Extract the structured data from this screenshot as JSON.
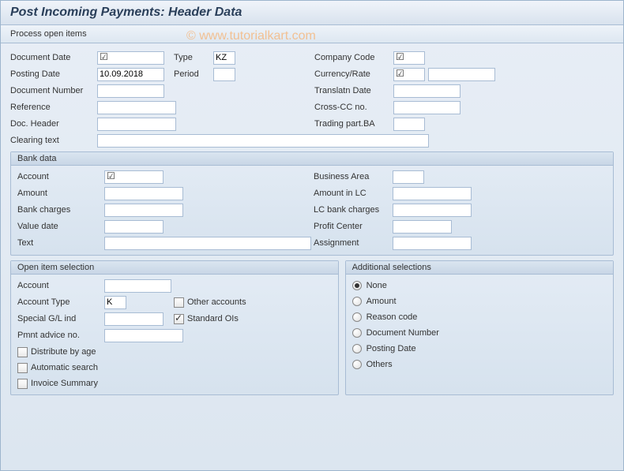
{
  "title": "Post Incoming Payments: Header Data",
  "toolbar": {
    "process_open_items": "Process open items"
  },
  "header": {
    "document_date_label": "Document Date",
    "document_date_value": "",
    "type_label": "Type",
    "type_value": "KZ",
    "company_code_label": "Company Code",
    "company_code_value": "",
    "posting_date_label": "Posting Date",
    "posting_date_value": "10.09.2018",
    "period_label": "Period",
    "period_value": "",
    "currency_rate_label": "Currency/Rate",
    "currency_rate_value": "",
    "currency_rate_value2": "",
    "document_number_label": "Document Number",
    "document_number_value": "",
    "translatn_date_label": "Translatn Date",
    "translatn_date_value": "",
    "reference_label": "Reference",
    "reference_value": "",
    "cross_cc_label": "Cross-CC no.",
    "cross_cc_value": "",
    "doc_header_label": "Doc. Header",
    "doc_header_value": "",
    "trading_part_label": "Trading part.BA",
    "trading_part_value": "",
    "clearing_text_label": "Clearing text",
    "clearing_text_value": ""
  },
  "bank": {
    "title": "Bank data",
    "account_label": "Account",
    "account_value": "",
    "business_area_label": "Business Area",
    "business_area_value": "",
    "amount_label": "Amount",
    "amount_value": "",
    "amount_lc_label": "Amount in LC",
    "amount_lc_value": "",
    "bank_charges_label": "Bank charges",
    "bank_charges_value": "",
    "lc_bank_charges_label": "LC bank charges",
    "lc_bank_charges_value": "",
    "value_date_label": "Value date",
    "value_date_value": "",
    "profit_center_label": "Profit Center",
    "profit_center_value": "",
    "text_label": "Text",
    "text_value": "",
    "assignment_label": "Assignment",
    "assignment_value": ""
  },
  "open_item": {
    "title": "Open item selection",
    "account_label": "Account",
    "account_value": "",
    "account_type_label": "Account Type",
    "account_type_value": "K",
    "other_accounts_label": "Other accounts",
    "special_gl_label": "Special G/L ind",
    "special_gl_value": "",
    "standard_ois_label": "Standard OIs",
    "pmnt_advice_label": "Pmnt advice no.",
    "pmnt_advice_value": "",
    "distribute_by_age_label": "Distribute by age",
    "automatic_search_label": "Automatic search",
    "invoice_summary_label": "Invoice Summary"
  },
  "additional": {
    "title": "Additional selections",
    "options": [
      {
        "label": "None",
        "selected": true
      },
      {
        "label": "Amount",
        "selected": false
      },
      {
        "label": "Reason code",
        "selected": false
      },
      {
        "label": "Document Number",
        "selected": false
      },
      {
        "label": "Posting Date",
        "selected": false
      },
      {
        "label": "Others",
        "selected": false
      }
    ]
  },
  "watermark": "© www.tutorialkart.com"
}
